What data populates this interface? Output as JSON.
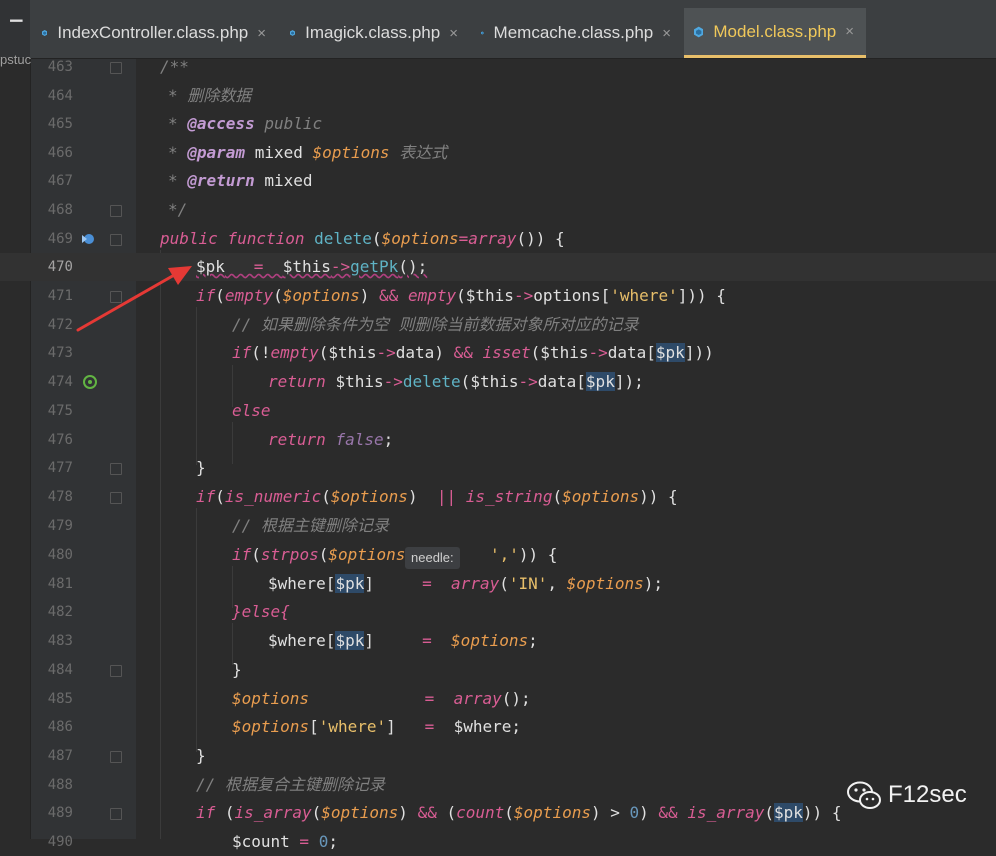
{
  "project_label": "pstuc",
  "tabs": [
    {
      "label": "IndexController.class.php",
      "close": "×",
      "active": false
    },
    {
      "label": "Imagick.class.php",
      "close": "×",
      "active": false
    },
    {
      "label": "Memcache.class.php",
      "close": "×",
      "active": false
    },
    {
      "label": "Model.class.php",
      "close": "×",
      "active": true
    }
  ],
  "colors": {
    "accent_active_tab": "#f0c85a",
    "php_file_icon": "#4fa8e0",
    "annotation_arrow": "#e53935"
  },
  "lines": [
    {
      "n": "463"
    },
    {
      "n": "464"
    },
    {
      "n": "465"
    },
    {
      "n": "466"
    },
    {
      "n": "467"
    },
    {
      "n": "468"
    },
    {
      "n": "469"
    },
    {
      "n": "470"
    },
    {
      "n": "471"
    },
    {
      "n": "472"
    },
    {
      "n": "473"
    },
    {
      "n": "474"
    },
    {
      "n": "475"
    },
    {
      "n": "476"
    },
    {
      "n": "477"
    },
    {
      "n": "478"
    },
    {
      "n": "479"
    },
    {
      "n": "480"
    },
    {
      "n": "481"
    },
    {
      "n": "482"
    },
    {
      "n": "483"
    },
    {
      "n": "484"
    },
    {
      "n": "485"
    },
    {
      "n": "486"
    },
    {
      "n": "487"
    },
    {
      "n": "488"
    },
    {
      "n": "489"
    },
    {
      "n": "490"
    }
  ],
  "code": {
    "c463": "/**",
    "c464": "* 删除数据",
    "c465_star": "* ",
    "c465_tag": "@access",
    "c465_rest": " public",
    "c466_star": "* ",
    "c466_tag": "@param",
    "c466_type": " mixed ",
    "c466_var": "$options",
    "c466_desc": " 表达式",
    "c467_star": "* ",
    "c467_tag": "@return",
    "c467_type": " mixed",
    "c468": "*/",
    "c469_pub": "public",
    "c469_func": " function ",
    "c469_name": "delete",
    "c469_p1": "(",
    "c469_var": "$options",
    "c469_eq": "=",
    "c469_arr": "array",
    "c469_rest": "()) {",
    "c470_pk": "$pk",
    "c470_eq": "   =  ",
    "c470_this": "$this",
    "c470_arrow": "->",
    "c470_m": "getPk",
    "c470_end": "();",
    "c471": [
      "if",
      "(",
      "empty",
      "(",
      "$options",
      ") ",
      "&&",
      " ",
      "empty",
      "(",
      "$this",
      "->",
      "options",
      "[",
      "'where'",
      "])) {"
    ],
    "c472": "// 如果删除条件为空 则删除当前数据对象所对应的记录",
    "c473": [
      "if",
      "(!",
      "empty",
      "(",
      "$this",
      "->",
      "data",
      ") ",
      "&&",
      " ",
      "isset",
      "(",
      "$this",
      "->",
      "data",
      "[",
      "$pk",
      "]))"
    ],
    "c474": [
      "return",
      " ",
      "$this",
      "->",
      "delete",
      "(",
      "$this",
      "->",
      "data",
      "[",
      "$pk",
      "]);"
    ],
    "c475": "else",
    "c476": [
      "return",
      " ",
      "false",
      ";"
    ],
    "c477": "}",
    "c478": [
      "if",
      "(",
      "is_numeric",
      "(",
      "$options",
      ")  ",
      "||",
      " ",
      "is_string",
      "(",
      "$options",
      ")) {"
    ],
    "c479": "// 根据主键删除记录",
    "c480": [
      "if",
      "(",
      "strpos",
      "(",
      "$options",
      ",",
      "','",
      ")) {"
    ],
    "c480_hint": "needle:",
    "c481": [
      "$where",
      "[",
      "$pk",
      "]",
      "     =  ",
      "array",
      "(",
      "'IN'",
      ", ",
      "$options",
      ");"
    ],
    "c482": "}else{",
    "c483": [
      "$where",
      "[",
      "$pk",
      "]",
      "     =  ",
      "$options",
      ";"
    ],
    "c484": "}",
    "c485": [
      "$options",
      "            =  ",
      "array",
      "();"
    ],
    "c486": [
      "$options",
      "[",
      "'where'",
      "]",
      "   =  ",
      "$where",
      ";"
    ],
    "c487": "}",
    "c488": "// 根据复合主键删除记录",
    "c489": [
      "if",
      " (",
      "is_array",
      "(",
      "$options",
      ") ",
      "&&",
      " (",
      "count",
      "(",
      "$options",
      ") > ",
      "0",
      ") ",
      "&&",
      " ",
      "is_array",
      "(",
      "$pk",
      ")) {"
    ],
    "c490": [
      "$count",
      " = ",
      "0",
      ";"
    ]
  },
  "watermark": {
    "icon": "wechat-icon",
    "text": "F12sec"
  }
}
